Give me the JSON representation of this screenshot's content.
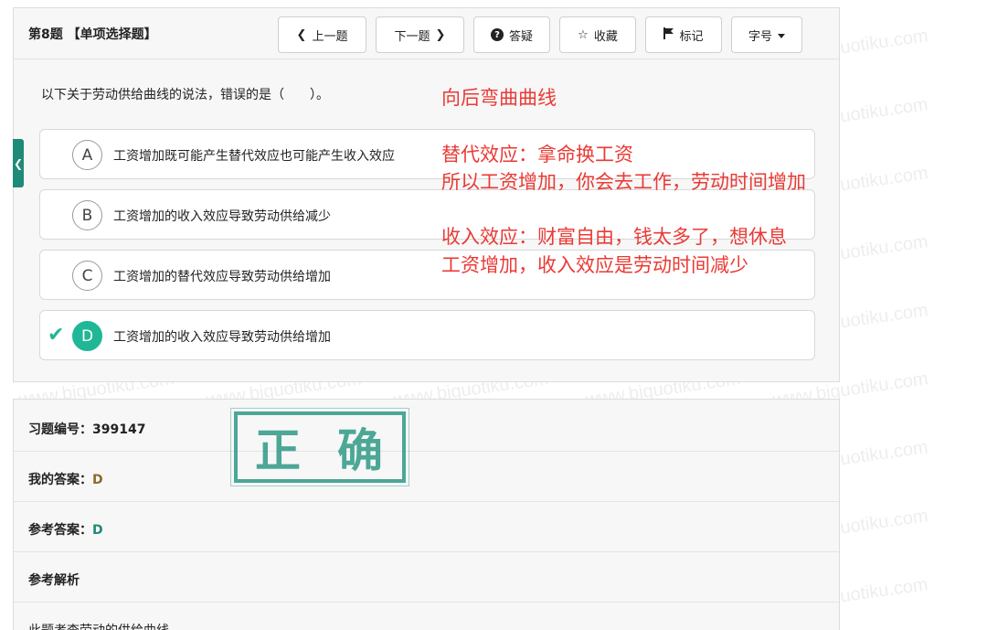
{
  "question": {
    "title": "第8题 【单项选择题】",
    "text": "以下关于劳动供给曲线的说法，错误的是（　　）。"
  },
  "toolbar": {
    "prev_label": "上一题",
    "next_label": "下一题",
    "qa_label": "答疑",
    "favorite_label": "收藏",
    "mark_label": "标记",
    "fontsize_label": "字号"
  },
  "icons": {
    "prev": "chevron-left-icon",
    "next": "chevron-right-icon",
    "qa": "question-circle-icon",
    "favorite": "star-outline-icon",
    "mark": "flag-icon",
    "fontsize_caret": "caret-down-icon",
    "side_tab": "chevron-left-icon",
    "correct": "check-icon"
  },
  "options": [
    {
      "letter": "A",
      "text": "工资增加既可能产生替代效应也可能产生收入效应",
      "correct": false
    },
    {
      "letter": "B",
      "text": "工资增加的收入效应导致劳动供给减少",
      "correct": false
    },
    {
      "letter": "C",
      "text": "工资增加的替代效应导致劳动供给增加",
      "correct": false
    },
    {
      "letter": "D",
      "text": "工资增加的收入效应导致劳动供给增加",
      "correct": true
    }
  ],
  "annotations": {
    "line1": "向后弯曲曲线",
    "line2": "替代效应：拿命换工资",
    "line3": "所以工资增加，你会去工作，劳动时间增加",
    "line4": "收入效应：财富自由，钱太多了，想休息",
    "line5": "工资增加，收入效应是劳动时间减少"
  },
  "stamp": {
    "char1": "正",
    "char2": "确"
  },
  "answer": {
    "id_label": "习题编号：",
    "id_value": "399147",
    "mine_label": "我的答案：",
    "mine_value": "D",
    "ref_label": "参考答案：",
    "ref_value": "D",
    "analysis_label": "参考解析",
    "analysis_text": "此题考查劳动的供给曲线。"
  },
  "watermark": "www.biguotiku.com",
  "colors": {
    "accent_green": "#20b796",
    "annotation_red": "#ea3a35",
    "stamp_green": "#2f9a86"
  }
}
